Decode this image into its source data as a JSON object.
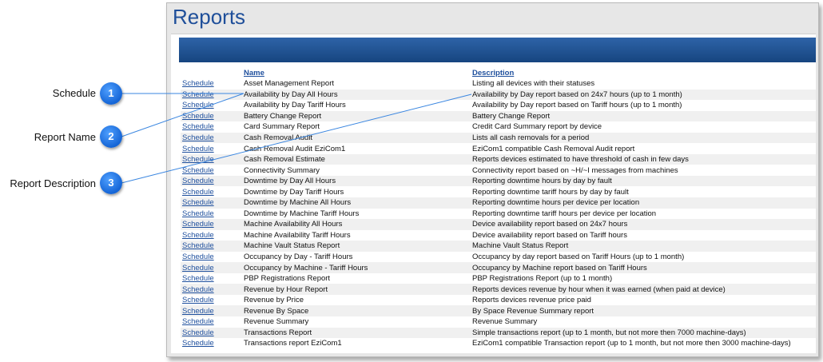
{
  "page_title": "Reports",
  "table": {
    "headers": [
      "",
      "Name",
      "Description"
    ],
    "rows": [
      {
        "action": "Schedule",
        "name": "Asset Management Report",
        "description": "Listing all devices with their statuses"
      },
      {
        "action": "Schedule",
        "name": "Availability by Day All Hours",
        "description": "Availability by Day report based on 24x7 hours (up to 1 month)"
      },
      {
        "action": "Schedule",
        "name": "Availability by Day Tariff Hours",
        "description": "Availability by Day report based on Tariff hours (up to 1 month)"
      },
      {
        "action": "Schedule",
        "name": "Battery Change Report",
        "description": "Battery Change Report"
      },
      {
        "action": "Schedule",
        "name": "Card Summary Report",
        "description": "Credit Card Summary report by device"
      },
      {
        "action": "Schedule",
        "name": "Cash Removal Audit",
        "description": "Lists all cash removals for a period"
      },
      {
        "action": "Schedule",
        "name": "Cash Removal Audit EziCom1",
        "description": "EziCom1 compatible Cash Removal Audit report"
      },
      {
        "action": "Schedule",
        "name": "Cash Removal Estimate",
        "description": "Reports devices estimated to have threshold of cash in few days"
      },
      {
        "action": "Schedule",
        "name": "Connectivity Summary",
        "description": "Connectivity report based on ~H/~I messages from machines"
      },
      {
        "action": "Schedule",
        "name": "Downtime by Day All Hours",
        "description": "Reporting downtime hours by day by fault"
      },
      {
        "action": "Schedule",
        "name": "Downtime by Day Tariff Hours",
        "description": "Reporting downtime tariff hours by day by fault"
      },
      {
        "action": "Schedule",
        "name": "Downtime by Machine All Hours",
        "description": "Reporting downtime hours per device per location"
      },
      {
        "action": "Schedule",
        "name": "Downtime by Machine Tariff Hours",
        "description": "Reporting downtime tariff hours per device per location"
      },
      {
        "action": "Schedule",
        "name": "Machine Availability All Hours",
        "description": "Device availability report based on 24x7 hours"
      },
      {
        "action": "Schedule",
        "name": "Machine Availability Tariff Hours",
        "description": "Device availability report based on Tariff hours"
      },
      {
        "action": "Schedule",
        "name": "Machine Vault Status Report",
        "description": "Machine Vault Status Report"
      },
      {
        "action": "Schedule",
        "name": "Occupancy by Day - Tariff Hours",
        "description": "Occupancy by day report based on Tariff Hours (up to 1 month)"
      },
      {
        "action": "Schedule",
        "name": "Occupancy by Machine - Tariff Hours",
        "description": "Occupancy by Machine report based on Tariff Hours"
      },
      {
        "action": "Schedule",
        "name": "PBP Registrations Report",
        "description": "PBP Registrations Report (up to 1 month)"
      },
      {
        "action": "Schedule",
        "name": "Revenue by Hour Report",
        "description": "Reports devices revenue by hour when it was earned (when paid at device)"
      },
      {
        "action": "Schedule",
        "name": "Revenue by Price",
        "description": "Reports devices revenue price paid"
      },
      {
        "action": "Schedule",
        "name": "Revenue By Space",
        "description": "By Space Revenue Summary report"
      },
      {
        "action": "Schedule",
        "name": "Revenue Summary",
        "description": "Revenue Summary"
      },
      {
        "action": "Schedule",
        "name": "Transactions Report",
        "description": "Simple transactions report (up to 1 month, but not more then 7000 machine-days)"
      },
      {
        "action": "Schedule",
        "name": "Transactions report EziCom1",
        "description": "EziCom1 compatible Transaction report (up to 1 month, but not more then 3000 machine-days)"
      }
    ]
  },
  "callouts": [
    {
      "number": "1",
      "label": "Schedule"
    },
    {
      "number": "2",
      "label": "Report Name"
    },
    {
      "number": "3",
      "label": "Report Description"
    }
  ],
  "colors": {
    "accent": "#1e4f9d",
    "bubble": "#1565d6",
    "header_bar": "#16457f"
  }
}
